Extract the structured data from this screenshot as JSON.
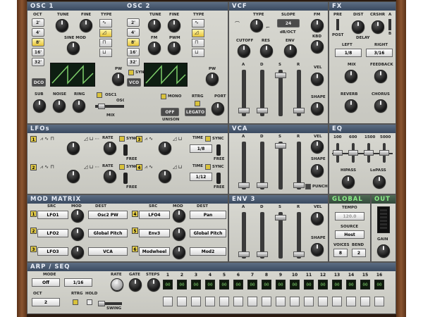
{
  "sections": {
    "osc1": "OSC 1",
    "osc2": "OSC 2",
    "vcf": "VCF",
    "fx": "FX",
    "lfos": "LFOs",
    "vca": "VCA",
    "eq": "EQ",
    "mod_matrix": "MOD MATRIX",
    "env3": "ENV 3",
    "global": "GLOBAL",
    "out": "OUT",
    "arp": "ARP / SEQ"
  },
  "osc1": {
    "oct_label": "OCT",
    "tune_label": "TUNE",
    "fine_label": "FINE",
    "type_label": "TYPE",
    "octaves": [
      "2'",
      "4'",
      "8'",
      "16'",
      "32'"
    ],
    "selected_octave": "8'",
    "sine_mod_label": "SINE MOD",
    "pw_label": "PW",
    "dco_label": "DCO",
    "sub_label": "SUB",
    "noise_label": "NOISE",
    "ring_label": "RING",
    "osc1_label": "OSC1",
    "osc2_label": "OSC2",
    "mix_label": "MIX"
  },
  "osc2": {
    "tune_label": "TUNE",
    "fine_label": "FINE",
    "type_label": "TYPE",
    "octaves": [
      "2'",
      "4'",
      "8'",
      "16'",
      "32'"
    ],
    "fm_label": "FM",
    "pwm_label": "PWM",
    "pw_label": "PW",
    "sync_label": "SYNC",
    "vco_label": "VCO",
    "mono_label": "MONO",
    "rtrg_label": "RTRG",
    "port_label": "PORT",
    "unison_off": "OFF",
    "unison_label": "UNISON",
    "legato_label": "LEGATO"
  },
  "vcf": {
    "type_label": "TYPE",
    "slope_label": "SLOPE",
    "slope_value": "24",
    "slope_unit": "dB/OCT",
    "fm_label": "FM",
    "kbd_label": "KBD",
    "cutoff_label": "CUTOFF",
    "res_label": "RES",
    "env_label": "ENV",
    "vel_label": "VEL",
    "shape_label": "SHAPE",
    "adsr": [
      "A",
      "D",
      "S",
      "R"
    ]
  },
  "fx": {
    "pre_label": "PRE",
    "dist_label": "DIST",
    "crshr_label": "CRSHR",
    "a_label": "A",
    "b_label": "B",
    "post_label": "POST",
    "delay_label": "DELAY",
    "left_label": "LEFT",
    "right_label": "RIGHT",
    "left_value": "1/8",
    "right_value": "3/16",
    "mix_label": "MIX",
    "feedback_label": "FEEDBACK",
    "reverb_label": "REVERB",
    "chorus_label": "CHORUS"
  },
  "lfos": {
    "rate_label": "RATE",
    "sync_label": "SYNC",
    "free_label": "FREE",
    "time_label": "TIME",
    "lfo3_value": "1/8",
    "lfo4_value": "1/12",
    "numbers": [
      "1",
      "2",
      "3",
      "4"
    ]
  },
  "vca": {
    "adsr": [
      "A",
      "D",
      "S",
      "R"
    ],
    "vel_label": "VEL",
    "shape_label": "SHAPE",
    "punch_label": "PUNCH"
  },
  "eq": {
    "freqs": [
      "100",
      "600",
      "1500",
      "5000"
    ],
    "hipass_label": "HIPASS",
    "lopass_label": "LoPASS"
  },
  "mod_matrix": {
    "src_label": "SRC",
    "mod_label": "MOD",
    "dest_label": "DEST",
    "rows": [
      {
        "n": "1",
        "src": "LFO1",
        "dest": "Osc2 PW"
      },
      {
        "n": "2",
        "src": "LFO2",
        "dest": "Global Pitch"
      },
      {
        "n": "3",
        "src": "LFO3",
        "dest": "VCA"
      },
      {
        "n": "4",
        "src": "LFO4",
        "dest": "Pan"
      },
      {
        "n": "5",
        "src": "Env3",
        "dest": "Global Pitch"
      },
      {
        "n": "6",
        "src": "Modwheel",
        "dest": "Mod2"
      }
    ]
  },
  "env3": {
    "adsr": [
      "A",
      "D",
      "S",
      "R"
    ],
    "vel_label": "VEL",
    "shape_label": "SHAPE"
  },
  "global": {
    "tempo_label": "TEMPO",
    "tempo_value": "120.0",
    "source_label": "SOURCE",
    "source_value": "Host",
    "voices_label": "VOICES",
    "bend_label": "BEND",
    "voices_value": "8",
    "bend_value": "2"
  },
  "out": {
    "gain_label": "GAIN"
  },
  "arp": {
    "mode_label": "MODE",
    "mode_value": "Off",
    "rate_label": "RATE",
    "rate_value": "1/16",
    "gate_label": "GATE",
    "steps_label": "STEPS",
    "oct_label": "OCT",
    "oct_value": "2",
    "rtrg_label": "RTRG",
    "hold_label": "HOLD",
    "swing_label": "SWING",
    "step_numbers": [
      "1",
      "2",
      "3",
      "4",
      "5",
      "6",
      "7",
      "8",
      "9",
      "10",
      "11",
      "12",
      "13",
      "14",
      "15",
      "16"
    ],
    "step_values": [
      "00",
      "00",
      "00",
      "00",
      "00",
      "00",
      "00",
      "00",
      "00",
      "00",
      "00",
      "00",
      "00",
      "00",
      "00",
      "00"
    ]
  },
  "colors": {
    "header": "#4a5a70",
    "panel": "#cfcfc8",
    "led": "#d9c23b",
    "wood": "#7a4a28"
  }
}
